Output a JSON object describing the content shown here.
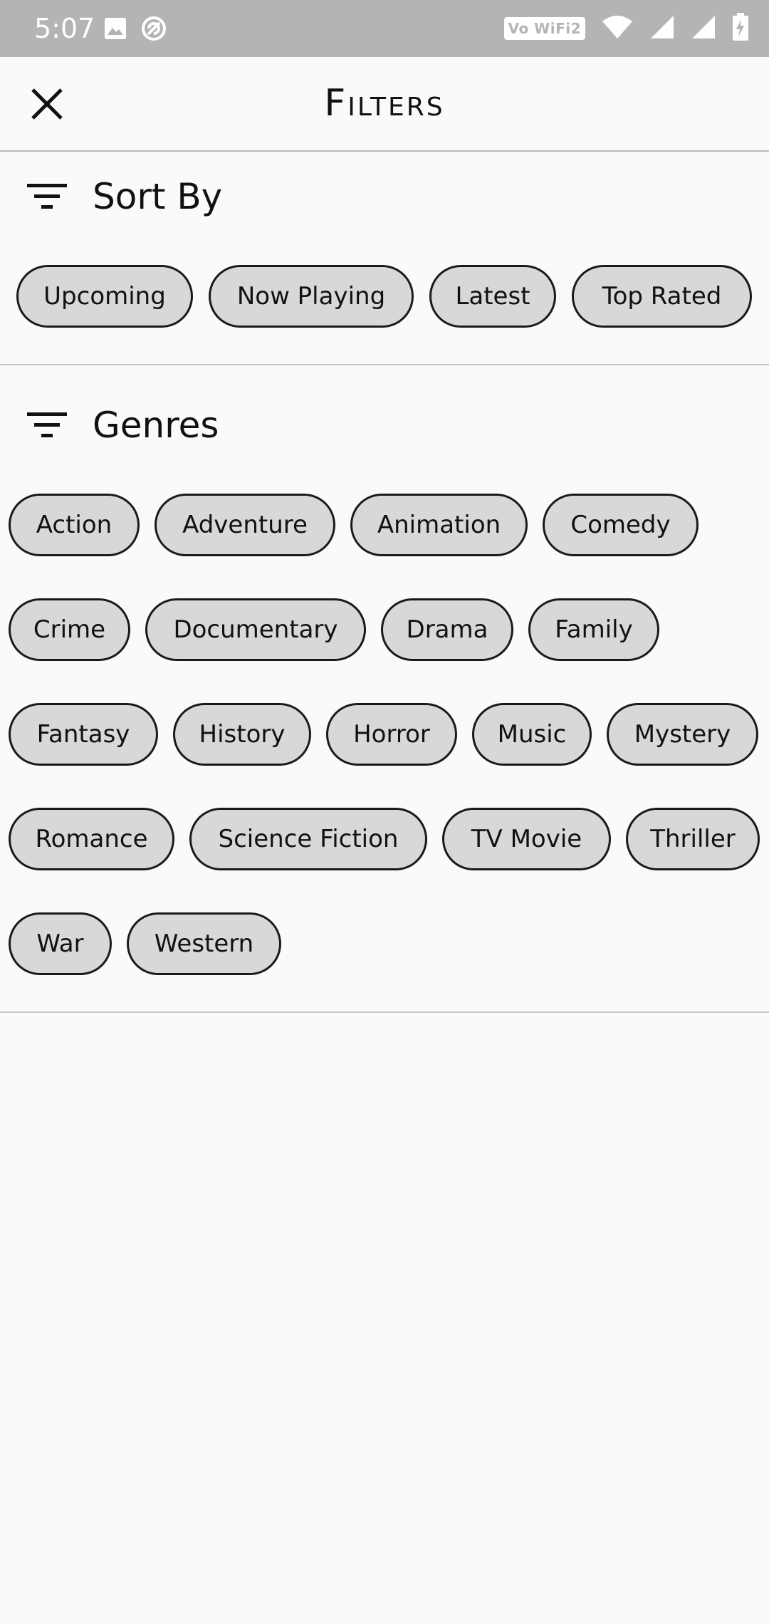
{
  "status_bar": {
    "time": "5:07",
    "wifi_label": "Vo WiFi2",
    "icons": [
      "image-icon",
      "sync-icon",
      "wifi-icon",
      "signal-icon",
      "signal-icon-2",
      "battery-charging-icon"
    ]
  },
  "app_bar": {
    "title": "Filters",
    "close_icon": "close-icon"
  },
  "sort_by": {
    "title": "Sort By",
    "icon": "filter-icon",
    "options": [
      "Upcoming",
      "Now Playing",
      "Latest",
      "Top Rated"
    ]
  },
  "genres": {
    "title": "Genres",
    "icon": "filter-icon",
    "options": [
      "Action",
      "Adventure",
      "Animation",
      "Comedy",
      "Crime",
      "Documentary",
      "Drama",
      "Family",
      "Fantasy",
      "History",
      "Horror",
      "Music",
      "Mystery",
      "Romance",
      "Science Fiction",
      "TV Movie",
      "Thriller",
      "War",
      "Western"
    ]
  },
  "colors": {
    "status_bar": "#b4b4b4",
    "background": "#fafafa",
    "chip_fill": "#d8d8d8",
    "chip_border": "#1a1a1a",
    "divider": "#c8c8c8"
  }
}
